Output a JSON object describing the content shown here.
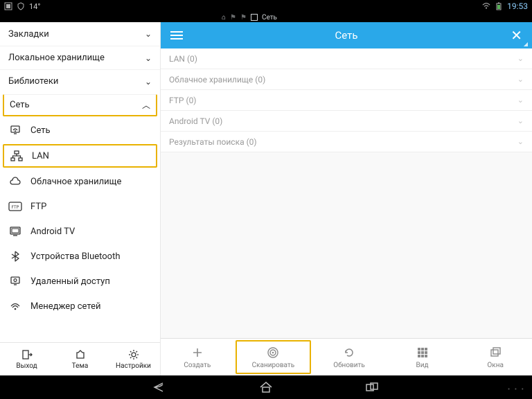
{
  "statusbar": {
    "temp": "14°",
    "time": "19:53"
  },
  "notif": {
    "tab_label": "Сеть"
  },
  "sidebar": {
    "categories": [
      {
        "label": "Закладки",
        "expanded": false
      },
      {
        "label": "Локальное хранилище",
        "expanded": false
      },
      {
        "label": "Библиотеки",
        "expanded": false
      },
      {
        "label": "Сеть",
        "expanded": true
      }
    ],
    "network_items": [
      {
        "label": "Сеть"
      },
      {
        "label": "LAN"
      },
      {
        "label": "Облачное хранилище"
      },
      {
        "label": "FTP"
      },
      {
        "label": "Android TV"
      },
      {
        "label": "Устройства Bluetooth"
      },
      {
        "label": "Удаленный доступ"
      },
      {
        "label": "Менеджер сетей"
      }
    ],
    "bottom": [
      {
        "label": "Выход"
      },
      {
        "label": "Тема"
      },
      {
        "label": "Настройки"
      }
    ]
  },
  "main": {
    "header_title": "Сеть",
    "rows": [
      {
        "label": "LAN (0)"
      },
      {
        "label": "Облачное хранилище (0)"
      },
      {
        "label": "FTP (0)"
      },
      {
        "label": "Android TV (0)"
      },
      {
        "label": "Результаты поиска (0)"
      }
    ],
    "toolbar": [
      {
        "label": "Создать"
      },
      {
        "label": "Сканировать"
      },
      {
        "label": "Обновить"
      },
      {
        "label": "Вид"
      },
      {
        "label": "Окна"
      }
    ]
  }
}
